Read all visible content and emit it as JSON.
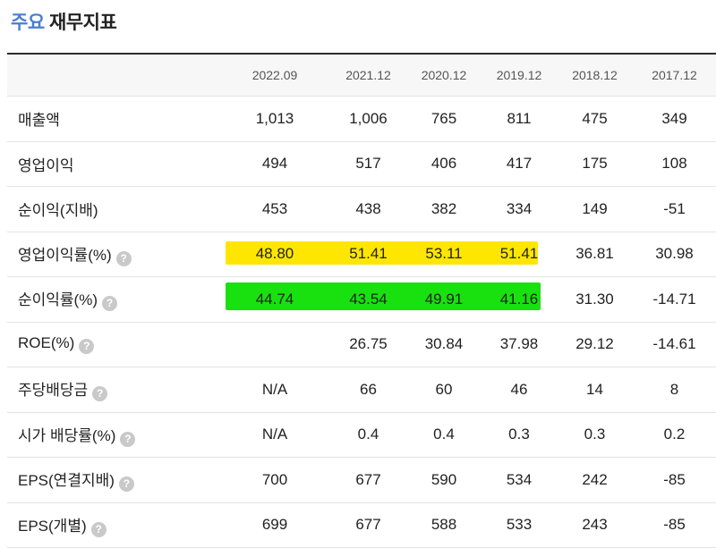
{
  "title": {
    "accent": "주요",
    "main": "재무지표"
  },
  "columns": [
    "2022.09",
    "2021.12",
    "2020.12",
    "2019.12",
    "2018.12",
    "2017.12"
  ],
  "rows": [
    {
      "label": "매출액",
      "help": false,
      "values": [
        "1,013",
        "1,006",
        "765",
        "811",
        "475",
        "349"
      ]
    },
    {
      "label": "영업이익",
      "help": false,
      "values": [
        "494",
        "517",
        "406",
        "417",
        "175",
        "108"
      ]
    },
    {
      "label": "순이익(지배)",
      "help": false,
      "values": [
        "453",
        "438",
        "382",
        "334",
        "149",
        "-51"
      ]
    },
    {
      "label": "영업이익률(%)",
      "help": true,
      "values": [
        "48.80",
        "51.41",
        "53.11",
        "51.41",
        "36.81",
        "30.98"
      ]
    },
    {
      "label": "순이익률(%)",
      "help": true,
      "values": [
        "44.74",
        "43.54",
        "49.91",
        "41.16",
        "31.30",
        "-14.71"
      ]
    },
    {
      "label": "ROE(%)",
      "help": true,
      "values": [
        "",
        "26.75",
        "30.84",
        "37.98",
        "29.12",
        "-14.61"
      ]
    },
    {
      "label": "주당배당금",
      "help": true,
      "values": [
        "N/A",
        "66",
        "60",
        "46",
        "14",
        "8"
      ]
    },
    {
      "label": "시가 배당률(%)",
      "help": true,
      "values": [
        "N/A",
        "0.4",
        "0.4",
        "0.3",
        "0.3",
        "0.2"
      ]
    },
    {
      "label": "EPS(연결지배)",
      "help": true,
      "values": [
        "700",
        "677",
        "590",
        "534",
        "242",
        "-85"
      ]
    },
    {
      "label": "EPS(개별)",
      "help": true,
      "values": [
        "699",
        "677",
        "588",
        "533",
        "243",
        "-85"
      ]
    }
  ],
  "help_glyph": "?",
  "highlights": [
    {
      "row": 3,
      "color": "#ffe600"
    },
    {
      "row": 4,
      "color": "#19e10f"
    }
  ]
}
